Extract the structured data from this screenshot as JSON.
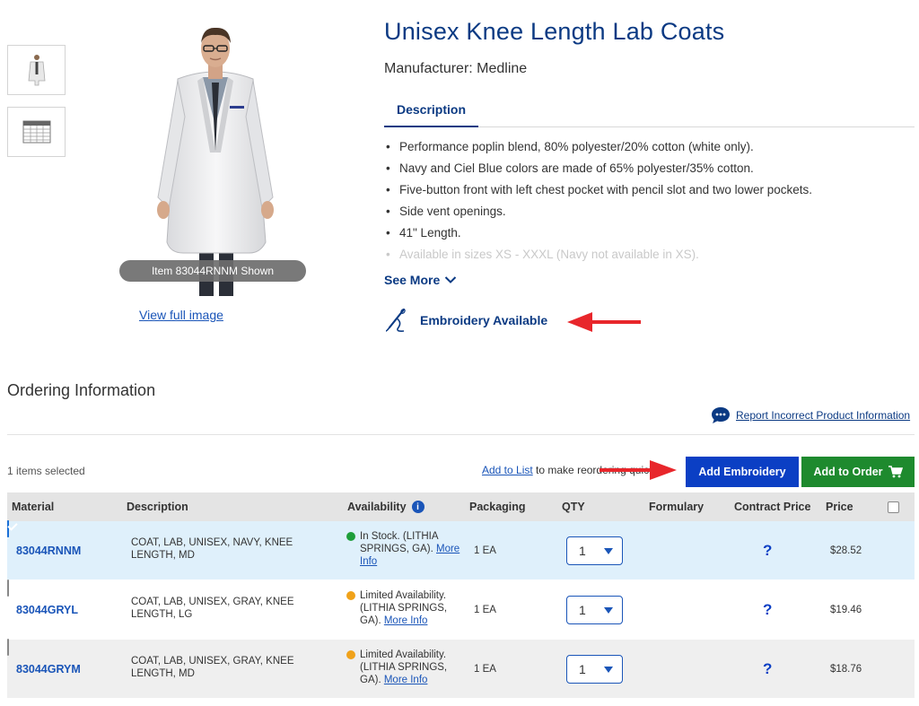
{
  "product": {
    "title": "Unisex Knee Length Lab Coats",
    "manufacturer": "Manufacturer: Medline",
    "image_badge": "Item 83044RNNM Shown",
    "view_full_image": "View full image",
    "tab_description": "Description",
    "bullets": [
      "Performance poplin blend, 80% polyester/20% cotton (white only).",
      "Navy and Ciel Blue colors are made of 65% polyester/35% cotton.",
      "Five-button front with left chest pocket with pencil slot and two lower pockets.",
      "Side vent openings.",
      "41\" Length.",
      "Available in sizes XS - XXXL (Navy not available in XS)."
    ],
    "see_more": "See More",
    "embroidery_available": "Embroidery Available"
  },
  "ordering": {
    "title": "Ordering Information",
    "report_link": "Report Incorrect Product Information",
    "selected_count": "1 items selected",
    "add_to_list": "Add to List",
    "reorder_text": "to make reordering quick or",
    "add_embroidery": "Add Embroidery",
    "add_to_order": "Add to Order"
  },
  "table": {
    "headers": {
      "material": "Material",
      "description": "Description",
      "availability": "Availability",
      "packaging": "Packaging",
      "qty": "QTY",
      "formulary": "Formulary",
      "contract_price": "Contract Price",
      "price": "Price"
    },
    "rows": [
      {
        "material": "83044RNNM",
        "description": "COAT, LAB, UNISEX, NAVY, KNEE LENGTH, MD",
        "availability": "In Stock. (LITHIA SPRINGS, GA).",
        "status_color": "#1e9e3a",
        "more_info": "More Info",
        "packaging": "1 EA",
        "qty": "1",
        "contract": "?",
        "price": "$28.52",
        "checked": true
      },
      {
        "material": "83044GRYL",
        "description": "COAT, LAB, UNISEX, GRAY, KNEE LENGTH, LG",
        "availability": "Limited Availability. (LITHIA SPRINGS, GA).",
        "status_color": "#f0a21a",
        "more_info": "More Info",
        "packaging": "1 EA",
        "qty": "1",
        "contract": "?",
        "price": "$19.46",
        "checked": false
      },
      {
        "material": "83044GRYM",
        "description": "COAT, LAB, UNISEX, GRAY, KNEE LENGTH, MD",
        "availability": "Limited Availability. (LITHIA SPRINGS, GA).",
        "status_color": "#f0a21a",
        "more_info": "More Info",
        "packaging": "1 EA",
        "qty": "1",
        "contract": "?",
        "price": "$18.76",
        "checked": false
      }
    ]
  },
  "colors": {
    "brand_navy": "#0b3a83",
    "link_blue": "#1a55b8",
    "button_blue": "#0b3fc4",
    "button_green": "#1e8a2e",
    "annotation_red": "#e8262b"
  }
}
